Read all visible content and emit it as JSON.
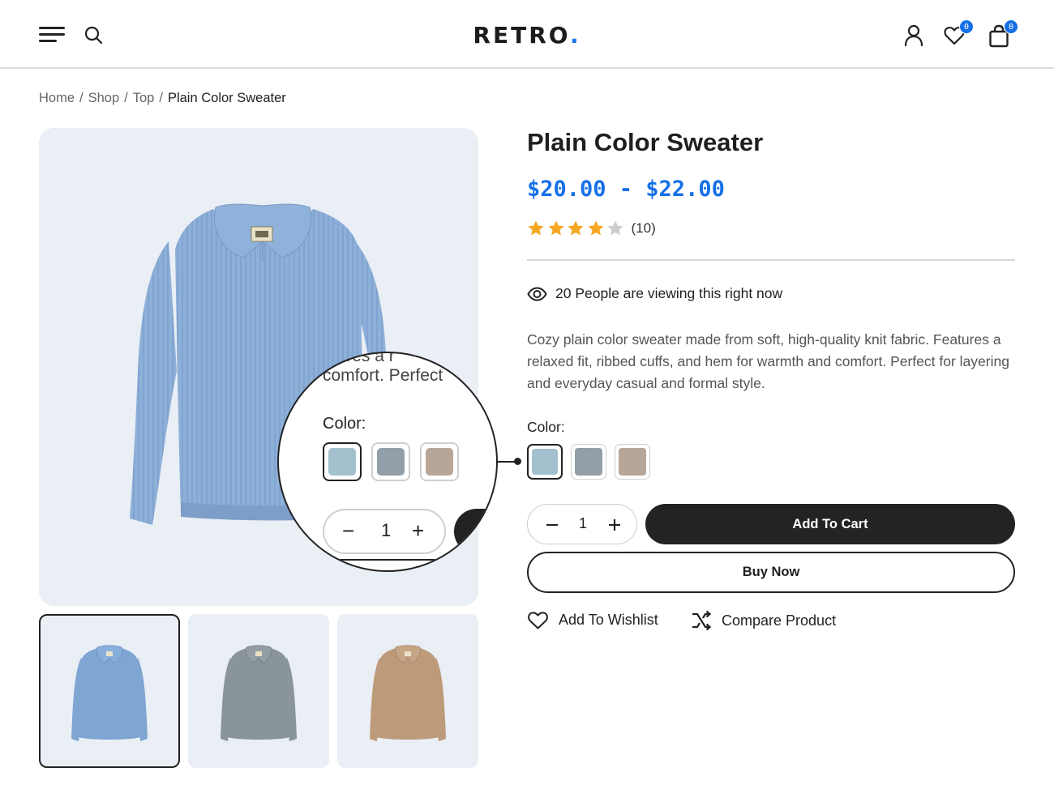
{
  "header": {
    "logo_text": "RETRO",
    "logo_dot": ".",
    "wishlist_count": "0",
    "cart_count": "0"
  },
  "breadcrumb": {
    "items": [
      "Home",
      "Shop",
      "Top"
    ],
    "separator": "/",
    "current": "Plain Color Sweater"
  },
  "product": {
    "title": "Plain Color Sweater",
    "price": "$20.00 - $22.00",
    "rating": 4,
    "rating_max": 5,
    "review_count": "(10)",
    "viewers_text": "20 People are viewing this right now",
    "description": "Cozy plain color sweater made from soft, high-quality knit fabric. Features a relaxed fit, ribbed cuffs, and hem for warmth and comfort. Perfect for layering and everyday casual and formal style.",
    "color_label": "Color:",
    "colors": [
      {
        "name": "blue",
        "hex": "#a3c0cf",
        "selected": true
      },
      {
        "name": "gray",
        "hex": "#929fa8",
        "selected": false
      },
      {
        "name": "beige",
        "hex": "#b7a698",
        "selected": false
      }
    ],
    "quantity": "1",
    "add_to_cart_label": "Add To Cart",
    "buy_now_label": "Buy Now",
    "wishlist_label": "Add To Wishlist",
    "compare_label": "Compare Product"
  },
  "magnifier": {
    "text_line1": "...ares a r",
    "text_line2": "comfort. Perfect",
    "color_label": "Color:",
    "quantity": "1"
  },
  "gallery": {
    "thumbnails": [
      {
        "color": "blue",
        "hex": "#7fa6d2",
        "active": true
      },
      {
        "color": "gray",
        "hex": "#8a949b",
        "active": false
      },
      {
        "color": "tan",
        "hex": "#bd9a7a",
        "active": false
      }
    ]
  },
  "colors": {
    "accent": "#1670e6",
    "star_filled": "#f5a623",
    "star_empty": "#cccccc",
    "dark": "#232323"
  }
}
